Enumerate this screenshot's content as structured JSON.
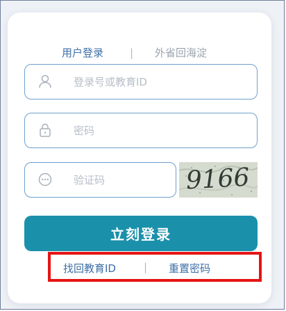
{
  "tabs": {
    "active": "用户登录",
    "separator": "|",
    "other": "外省回海淀"
  },
  "fields": {
    "username_placeholder": "登录号或教育ID",
    "password_placeholder": "密码",
    "captcha_placeholder": "验证码"
  },
  "captcha": {
    "text": "9166"
  },
  "button": {
    "login": "立刻登录"
  },
  "links": {
    "find_id": "找回教育ID",
    "separator": "|",
    "reset_password": "重置密码"
  },
  "colors": {
    "accent": "#1b90ab",
    "link": "#3e6fa6",
    "field_border": "#6f9fcc",
    "highlight_box": "#e51414"
  }
}
